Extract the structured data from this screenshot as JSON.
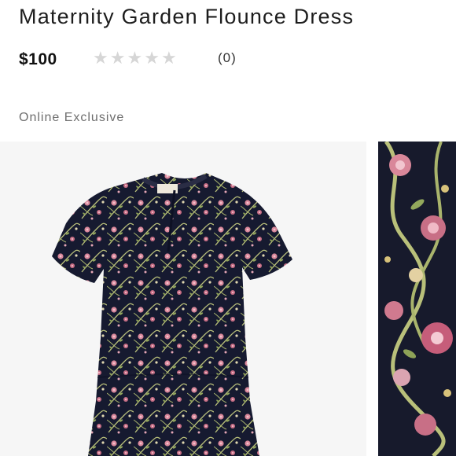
{
  "product": {
    "title": "Maternity Garden Flounce Dress",
    "price": "$100",
    "rating": {
      "stars": 5,
      "filled": 0,
      "count_label": "(0)"
    },
    "badge": "Online Exclusive"
  },
  "gallery": {
    "main_image_icon": "dress-photo",
    "thumbnail_icon": "fabric-closeup-photo"
  },
  "colors": {
    "dress_base": "#161a30",
    "flower_pink": "#d9879a",
    "vine_green": "#b9c07a",
    "star_empty": "#d6d6d6",
    "badge_text": "#6e6e6e"
  }
}
